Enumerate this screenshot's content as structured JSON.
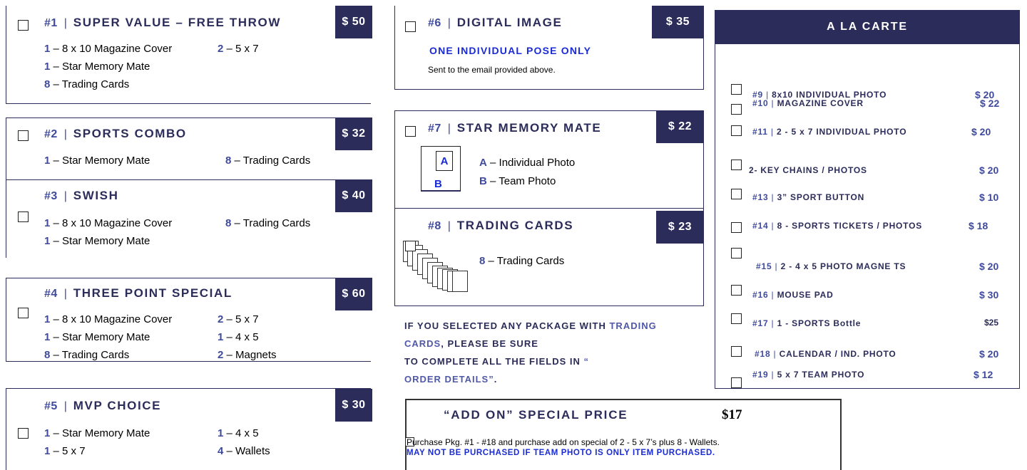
{
  "packages": {
    "p1": {
      "num": "#1",
      "name": "SUPER VALUE – FREE THROW",
      "price": "$ 50",
      "i1q": "1",
      "i1t": " – 8 x 10 Magazine Cover",
      "i2q": "2",
      "i2t": " – 5 x 7",
      "i3q": "1",
      "i3t": " – Star Memory Mate",
      "i4q": "8",
      "i4t": " – Trading Cards"
    },
    "p2": {
      "num": "#2",
      "name": "SPORTS COMBO",
      "price": "$ 32",
      "i1q": "1",
      "i1t": " – Star Memory Mate",
      "i2q": "8",
      "i2t": " – Trading Cards"
    },
    "p3": {
      "num": "#3",
      "name": "SWISH",
      "price": "$ 40",
      "i1q": "1",
      "i1t": " – 8 x 10 Magazine Cover",
      "i2q": "8",
      "i2t": " – Trading Cards",
      "i3q": "1",
      "i3t": " – Star Memory Mate"
    },
    "p4": {
      "num": "#4",
      "name": "THREE POINT SPECIAL",
      "price": "$ 60",
      "i1q": "1",
      "i1t": " – 8 x 10 Magazine Cover",
      "i2q": "2",
      "i2t": " – 5 x 7",
      "i3q": "1",
      "i3t": " – Star Memory Mate",
      "i4q": "1",
      "i4t": " – 4 x 5",
      "i5q": "8",
      "i5t": " – Trading Cards",
      "i6q": "2",
      "i6t": " – Magnets"
    },
    "p5": {
      "num": "#5",
      "name": "MVP CHOICE",
      "price": "$ 30",
      "i1q": "1",
      "i1t": " – Star Memory Mate",
      "i2q": "1",
      "i2t": " – 4 x 5",
      "i3q": "1",
      "i3t": " – 5 x 7",
      "i4q": "4",
      "i4t": " – Wallets"
    },
    "p6": {
      "num": "#6",
      "name": "DIGITAL IMAGE",
      "price": "$ 35",
      "line1": "ONE INDIVIDUAL POSE ONLY",
      "line2": "Sent to the email provided above."
    },
    "p7": {
      "num": "#7",
      "name": "STAR MEMORY MATE",
      "price": "$ 22",
      "aq": "A",
      "at": " – Individual Photo",
      "bq": "B",
      "bt": " – Team Photo",
      "diag_a": "A",
      "diag_b": "B"
    },
    "p8": {
      "num": "#8",
      "name": "TRADING CARDS",
      "price": "$ 23",
      "i1q": "8",
      "i1t": " – Trading Cards"
    }
  },
  "notice": {
    "l1a": "IF YOU SELECTED ANY PACKAGE WITH ",
    "l1b": "TRADING",
    "l2a": "CARDS",
    ", ": "",
    "l2b": ", PLEASE BE SURE",
    "l3a": "TO COMPLETE ALL THE FIELDS IN ",
    "l3b": "“",
    "l4a": "ORDER DETAILS”",
    "l4b": "."
  },
  "addon": {
    "title": "“ADD ON” SPECIAL PRICE",
    "price": "$17",
    "desc": "Purchase Pkg. #1 - #18 and purchase add on special of 2 - 5 x 7’s plus 8 - Wallets.",
    "warning": "MAY NOT BE PURCHASED IF TEAM PHOTO IS ONLY ITEM PURCHASED."
  },
  "alacarte": {
    "title": "A LA CARTE",
    "items": [
      {
        "num": "#9",
        "sep": " | ",
        "label": "8x10 INDIVIDUAL PHOTO",
        "price": "$ 20"
      },
      {
        "num": "#10",
        "sep": " | ",
        "label": "MAGAZINE COVER",
        "price": "$  22"
      },
      {
        "num": "#11",
        "sep": " | ",
        "label": "2 - 5 x 7 INDIVIDUAL PHOTO",
        "price": "$ 20"
      },
      {
        "num": "",
        "sep": "",
        "label": "2-  KEY CHAINS / PHOTOS",
        "price": "$  20"
      },
      {
        "num": "#13",
        "sep": " | ",
        "label": "3” SPORT BUTTON",
        "price": "$  10"
      },
      {
        "num": "#14",
        "sep": " | ",
        "label": "8 - SPORTS TICKETS / PHOTOS",
        "price": "$ 18"
      },
      {
        "num": "#15",
        "sep": " | ",
        "label": "2  -  4  x  5 PHOTO MAGNE TS",
        "price": "$  20"
      },
      {
        "num": "#16",
        "sep": " | ",
        "label": "MOUSE PAD",
        "price": "$  30"
      },
      {
        "num": "#17",
        "sep": " | ",
        "label": "1 - SPORTS Bottle",
        "price": "$25"
      },
      {
        "num": "#18",
        "sep": " | ",
        "label": "CALENDAR / IND. PHOTO",
        "price": "$  20"
      },
      {
        "num": "#19",
        "sep": " | ",
        "label": "5  x  7 TEAM PHOTO",
        "price": "$ 12"
      }
    ]
  }
}
